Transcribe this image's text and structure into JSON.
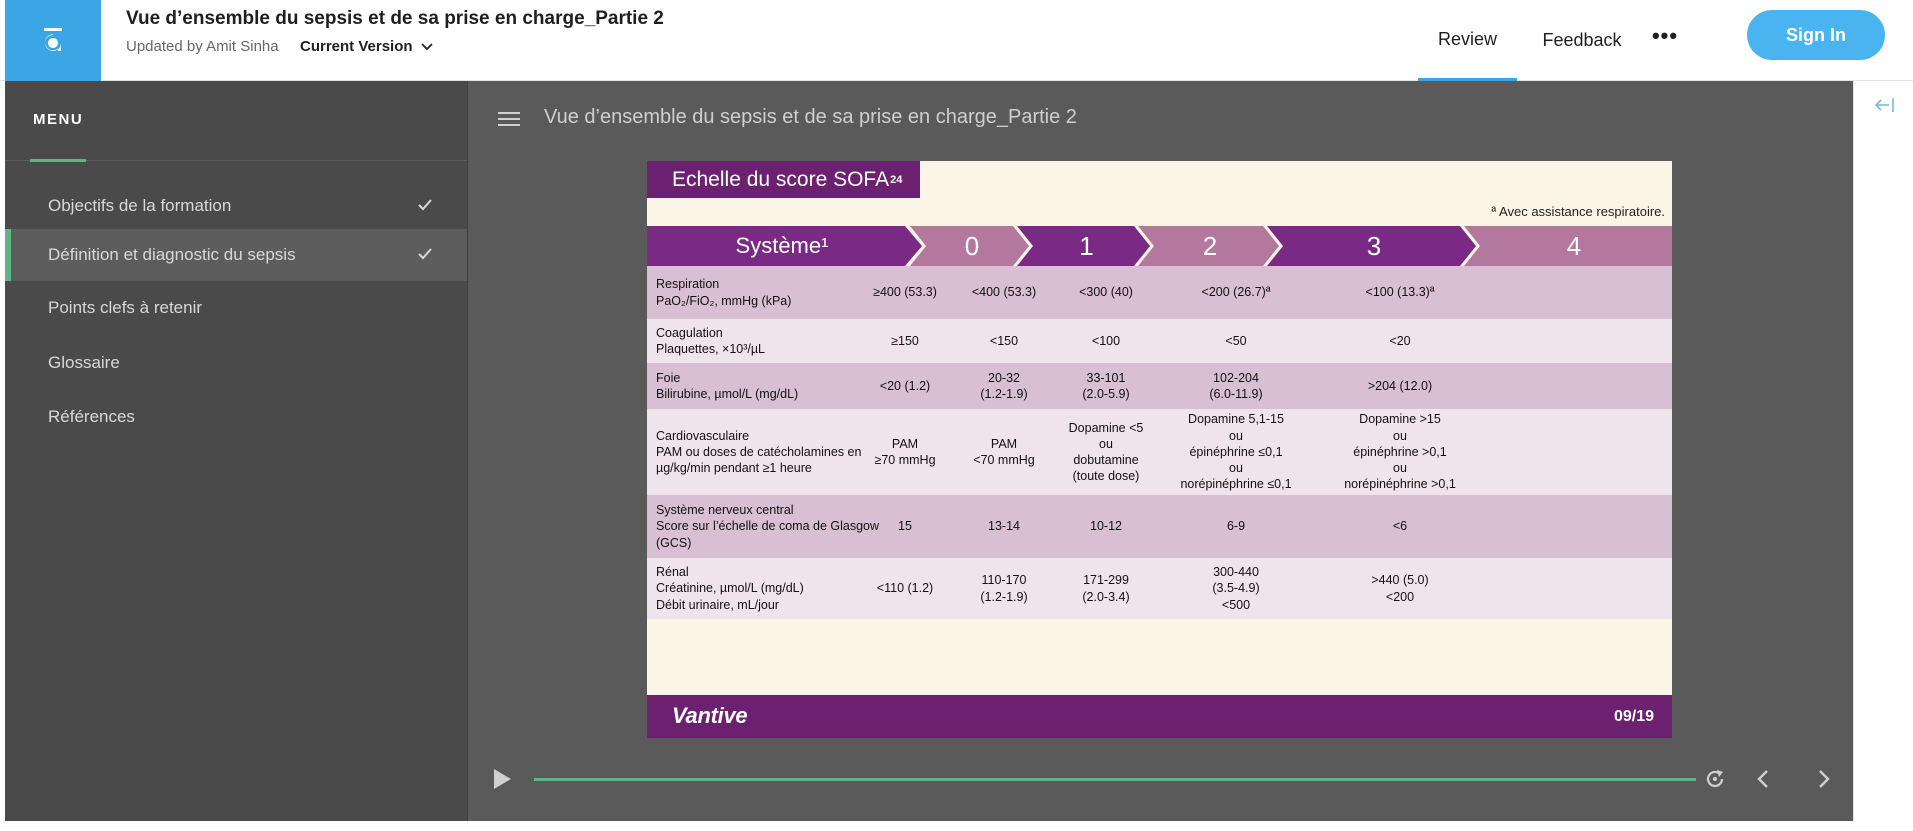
{
  "header": {
    "title": "Vue d’ensemble du sepsis et de sa prise en charge_Partie 2",
    "updated_by": "Updated by Amit Sinha",
    "version_label": "Current Version",
    "nav": {
      "review": "Review",
      "feedback": "Feedback",
      "more": "•••"
    },
    "signin_label": "Sign In",
    "logo_icon": "app-logo-icon",
    "accent": "#3aa6e6"
  },
  "sidebar": {
    "menu_label": "MENU",
    "items": [
      {
        "label": "Objectifs de la formation",
        "checked": true,
        "active": false
      },
      {
        "label": "Définition et diagnostic du sepsis",
        "checked": true,
        "active": true
      },
      {
        "label": "Points clefs à retenir",
        "checked": false,
        "active": false
      },
      {
        "label": "Glossaire",
        "checked": false,
        "active": false
      },
      {
        "label": "Références",
        "checked": false,
        "active": false
      }
    ]
  },
  "main": {
    "lesson_title": "Vue d’ensemble du sepsis et de sa prise en charge_Partie 2"
  },
  "slide": {
    "title": "Echelle du score SOFA",
    "title_sup": "24",
    "note": "ª Avec assistance respiratoire.",
    "header_cols": [
      "Système¹",
      "0",
      "1",
      "2",
      "3",
      "4"
    ],
    "rows": [
      {
        "head": [
          "Respiration",
          "PaO₂/FiO₂, mmHg (kPa)"
        ],
        "cells": [
          [
            "≥400 (53.3)"
          ],
          [
            "<400 (53.3)"
          ],
          [
            "<300 (40)"
          ],
          [
            "<200 (26.7)ª"
          ],
          [
            "<100 (13.3)ª"
          ]
        ]
      },
      {
        "head": [
          "Coagulation",
          "Plaquettes, ×10³/µL"
        ],
        "cells": [
          [
            "≥150"
          ],
          [
            "<150"
          ],
          [
            "<100"
          ],
          [
            "<50"
          ],
          [
            "<20"
          ]
        ]
      },
      {
        "head": [
          "Foie",
          "Bilirubine, µmol/L (mg/dL)"
        ],
        "cells": [
          [
            "<20 (1.2)"
          ],
          [
            "20-32",
            "(1.2-1.9)"
          ],
          [
            "33-101",
            "(2.0-5.9)"
          ],
          [
            "102-204",
            "(6.0-11.9)"
          ],
          [
            ">204 (12.0)"
          ]
        ]
      },
      {
        "head": [
          "Cardiovasculaire",
          "PAM ou doses de catécholamines en",
          "µg/kg/min pendant ≥1 heure"
        ],
        "cells": [
          [
            "PAM",
            "≥70 mmHg"
          ],
          [
            "PAM",
            "<70 mmHg"
          ],
          [
            "Dopamine <5",
            "ou",
            "dobutamine",
            "(toute dose)"
          ],
          [
            "Dopamine 5,1-15",
            "ou",
            "épinéphrine ≤0,1",
            "ou",
            "norépinéphrine ≤0,1"
          ],
          [
            "Dopamine >15",
            "ou",
            "épinéphrine >0,1",
            "ou",
            "norépinéphrine >0,1"
          ]
        ]
      },
      {
        "head": [
          "Système nerveux central",
          "Score sur l’échelle de coma de Glasgow",
          "(GCS)"
        ],
        "cells": [
          [
            "15"
          ],
          [
            "13-14"
          ],
          [
            "10-12"
          ],
          [
            "6-9"
          ],
          [
            "<6"
          ]
        ]
      },
      {
        "head": [
          "Rénal",
          "Créatinine, µmol/L (mg/dL)",
          "Débit urinaire, mL/jour"
        ],
        "cells": [
          [
            "<110 (1.2)"
          ],
          [
            "110-170",
            "(1.2-1.9)"
          ],
          [
            "171-299",
            "(2.0-3.4)"
          ],
          [
            "300-440",
            "(3.5-4.9)",
            "<500"
          ],
          [
            ">440 (5.0)",
            "<200"
          ]
        ]
      }
    ],
    "brand": "Vantive",
    "page": "09/19",
    "colors": {
      "purple": "#6b2070",
      "chevron_light": "#b4789f",
      "row_dark": "#d9bfd4",
      "row_light": "#efe4ec"
    }
  },
  "player": {
    "progress": 1.0,
    "icons": [
      "play-icon",
      "replay-icon",
      "chevron-left-icon",
      "chevron-right-icon"
    ]
  },
  "right_panel": {
    "icon": "collapse-panel-icon"
  }
}
